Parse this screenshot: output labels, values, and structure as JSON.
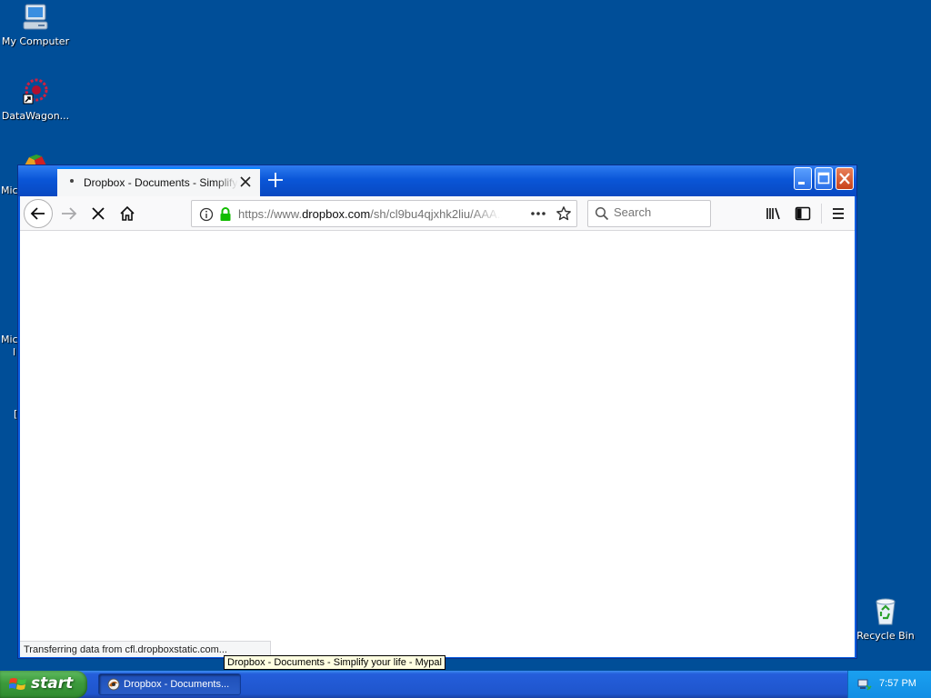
{
  "desktop": {
    "icons": [
      {
        "label": "My Computer",
        "icon": "my-computer-icon"
      },
      {
        "label": "DataWagon...",
        "icon": "datawagon-icon"
      },
      {
        "label": "Recycle Bin",
        "icon": "recycle-bin-icon"
      }
    ],
    "partial_labels": [
      "Micı",
      "Micı",
      "l",
      "["
    ]
  },
  "browser": {
    "tab": {
      "title": "Dropbox - Documents - Simplify your life - Mypal",
      "favicon": "loading-dot"
    },
    "url": {
      "prefix": "https://www.",
      "domain": "dropbox.com",
      "path": "/sh/cl9bu4qjxhk2liu/AAA..."
    },
    "search": {
      "placeholder": "Search"
    },
    "status": "Transferring data from cfl.dropboxstatic.com...",
    "tooltip": "Dropbox - Documents - Simplify your life - Mypal",
    "state": "loading"
  },
  "taskbar": {
    "start_label": "start",
    "task_label": "Dropbox - Documents...",
    "clock": "7:57 PM"
  },
  "colors": {
    "desktop": "#004e98",
    "titlebar": "#0a56d8",
    "start_green": "#3c9a3c",
    "tray": "#128ee4",
    "lock_green": "#12bc00"
  }
}
